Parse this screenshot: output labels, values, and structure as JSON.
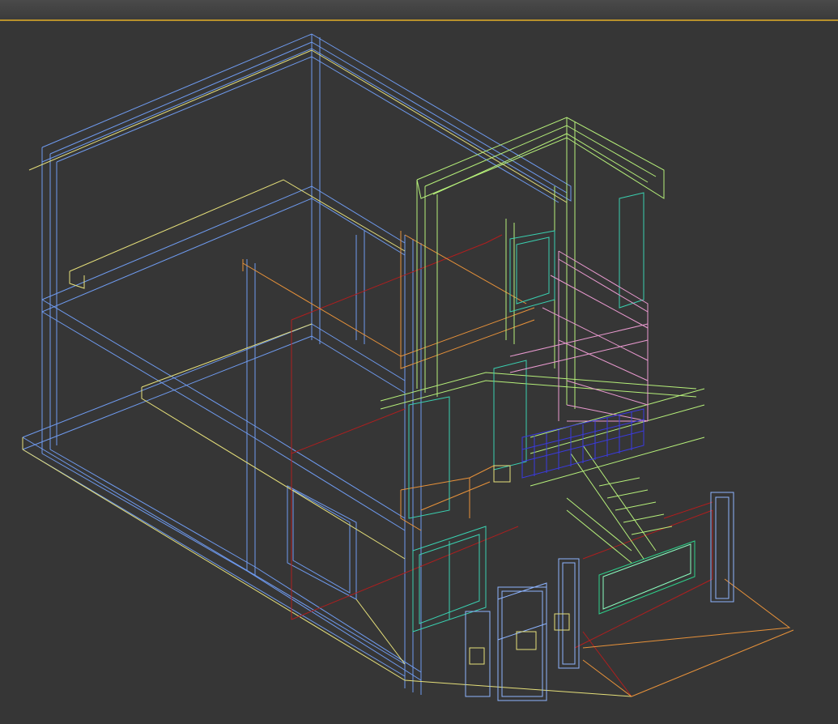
{
  "viewport": {
    "label": "",
    "mode": "wireframe"
  },
  "colors": {
    "background": "#363636",
    "header_border": "#b8912c",
    "structure": "#6f9bf0",
    "structure_light": "#8db4ff",
    "slab_yellow": "#e6e07a",
    "rail_lime": "#b6f07a",
    "frame_teal": "#3ad0b0",
    "pink_frames": "#ea9ad0",
    "orange_rails": "#e8923a",
    "red_lines": "#b01e1e",
    "blue_grille": "#3a3ae0",
    "gate_fill": "#1aa58a"
  }
}
